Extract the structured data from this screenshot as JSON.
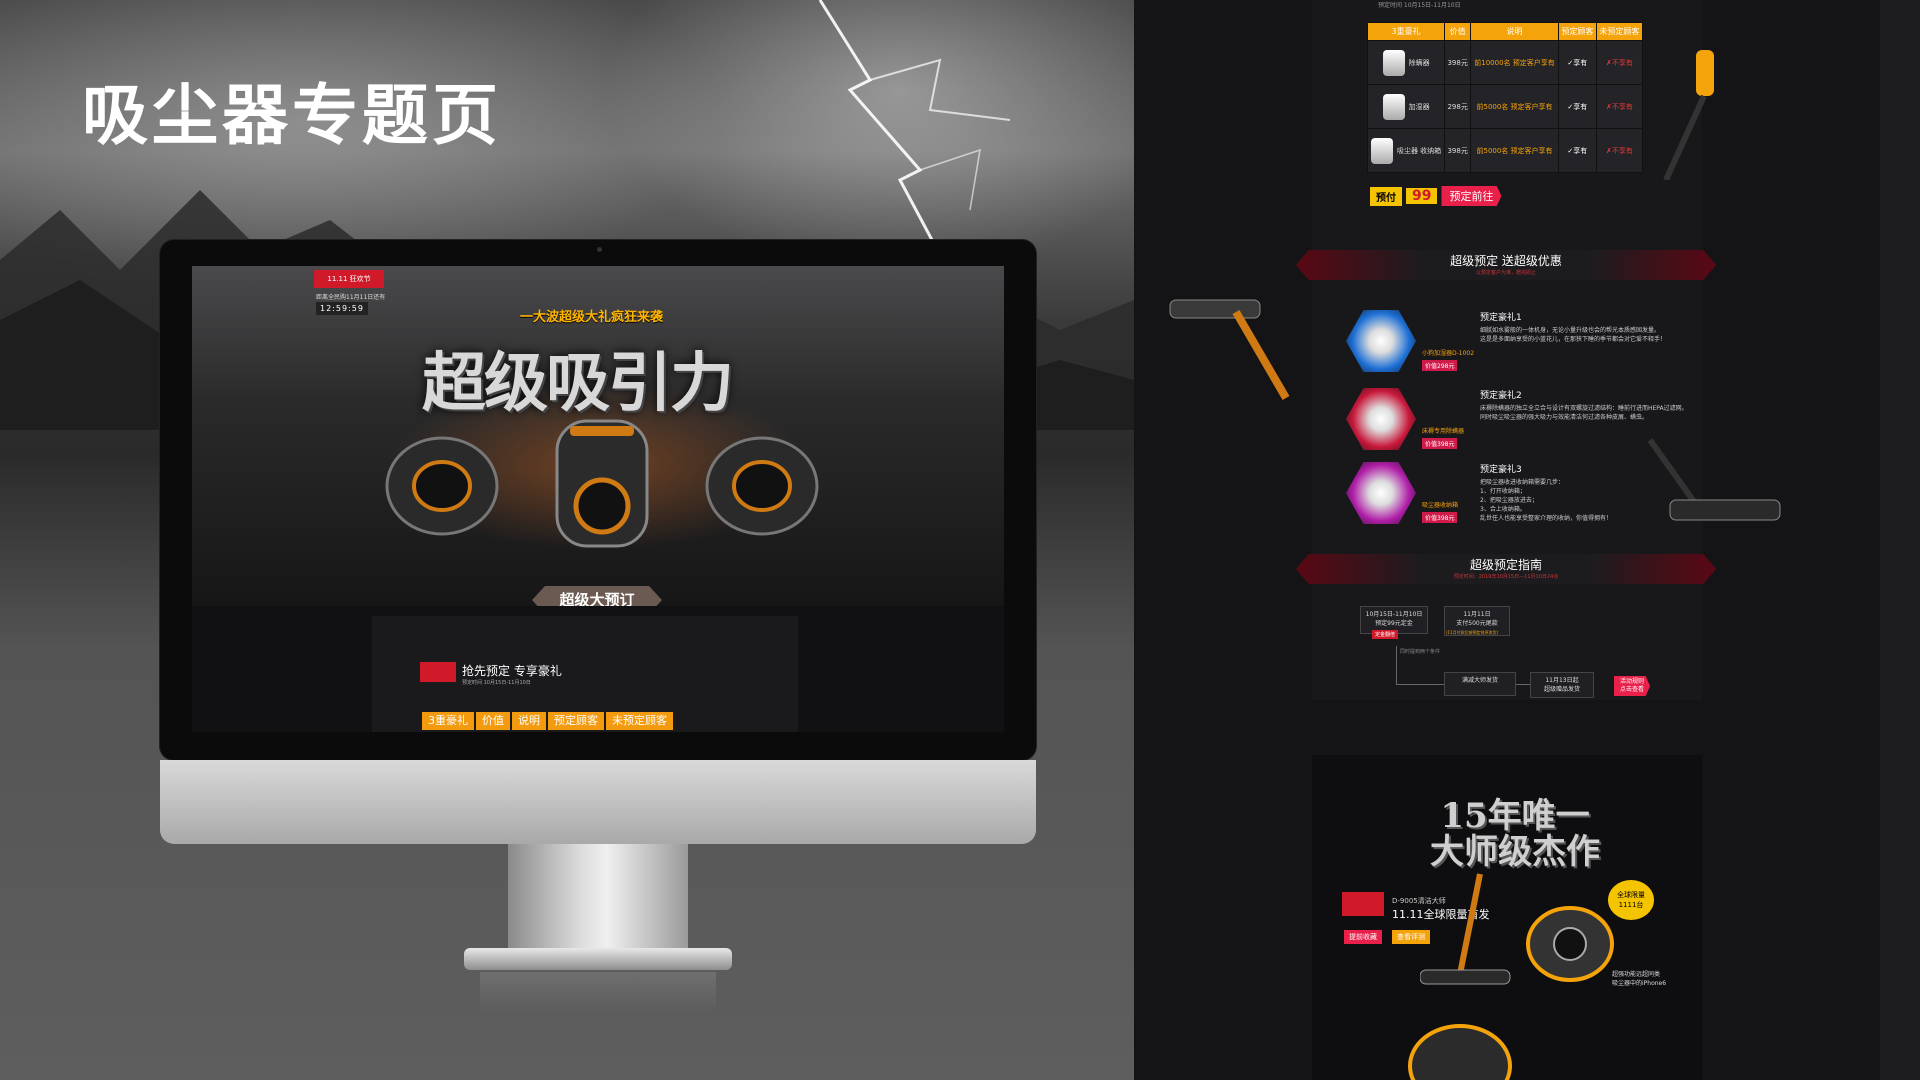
{
  "page_title": "吸尘器专题页",
  "monitor_screen": {
    "brand_badge": "11.11 狂欢节",
    "countdown_label": "距离全民购11月11日还有",
    "countdown": "12:59:59",
    "banner": "一大波超级大礼疯狂来袭",
    "hero_title": "超级吸引力",
    "cta_tag": "超级大预订",
    "preorder_title": "抢先预定 专享豪礼",
    "preorder_date": "预定时间 10月15日-11月10日",
    "tabs": [
      "3重豪礼",
      "价值",
      "说明",
      "预定顾客",
      "未预定顾客"
    ]
  },
  "long_page": {
    "top_date": "预定时间 10月15日-11月10日",
    "table": {
      "headers": [
        "3重豪礼",
        "价值",
        "说明",
        "预定顾客",
        "未预定顾客"
      ],
      "rows": [
        {
          "product": "除螨器",
          "value": "398元",
          "note": "前10000名 预定客户享有",
          "booked": "✓享有",
          "unbooked": "✗不享有"
        },
        {
          "product": "加湿器",
          "value": "298元",
          "note": "前5000名 预定客户享有",
          "booked": "✓享有",
          "unbooked": "✗不享有"
        },
        {
          "product": "吸尘器 收纳箱",
          "value": "398元",
          "note": "前5000名 预定客户享有",
          "booked": "✓享有",
          "unbooked": "✗不享有"
        }
      ]
    },
    "prepay": {
      "label": "预付",
      "amount": "99",
      "button": "预定前往"
    },
    "gifts_section": {
      "title": "超级预定 送超级优惠",
      "subtitle": "以预定客户为准，赠完即止"
    },
    "gifts": [
      {
        "title": "预定豪礼1",
        "name": "小狗加湿器D-1002",
        "price": "价值298元",
        "desc": "细腻如水雾般的一体机身，无论小量升级也会的帮光本质感固发量。\n这是是多面纳享受的小蓝花儿，在那狭下睡的季节都会对它爱不释手！",
        "color": "#1d6fd6"
      },
      {
        "title": "预定豪礼2",
        "name": "床褥专用除螨器",
        "price": "价值398元",
        "desc": "床褥除螨器的独立全立合与设计有双螺旋过滤结构：睡前行进而HEPA过滤网。\n同时吸尘吸尘器的强大吸力与效能清洁何过滤各种皮屑、螨虫。",
        "color": "#c8183a"
      },
      {
        "title": "预定豪礼3",
        "name": "吸尘器收纳箱",
        "price": "价值398元",
        "desc": "把吸尘器收进收纳箱需要几步：\n1、打开收纳箱；\n2、把吸尘器放进去；\n3、合上收纳箱。\n乱世任人也能享受整家介理的收纳，你值得拥有！",
        "color": "#b01ea8"
      }
    ],
    "guide": {
      "title": "超级预定指南",
      "subtitle": "预定时间：2019年10月15日—11月10日24点",
      "step1": "10月15日-11月10日\n预定99元定金",
      "step1_tag": "定金翻倍",
      "step2": "11月11日\n支付500元尾款",
      "step2_tag": "(11月付款后按预定排序发货)",
      "step3": "满减大师发货",
      "step4": "11月13日起\n超级赠品发货",
      "mid_note": "同时提到两个条件",
      "cta": "活动规则\n点击查看"
    },
    "bottom": {
      "headline": "15年唯一 大师级杰作",
      "model": "D-9005清洁大师",
      "launch": "11.11全球限量首发",
      "fav": "提前收藏",
      "review": "查看评测",
      "badge": "全球限量\n1111台",
      "note": "超强功能远超同类\n吸尘器中的iPhone6"
    }
  },
  "colors": {
    "accent_orange": "#f5a30a",
    "accent_red": "#d01a2a",
    "accent_pink": "#e8204a",
    "yellow": "#f5c400",
    "bg_dark": "#141417"
  }
}
